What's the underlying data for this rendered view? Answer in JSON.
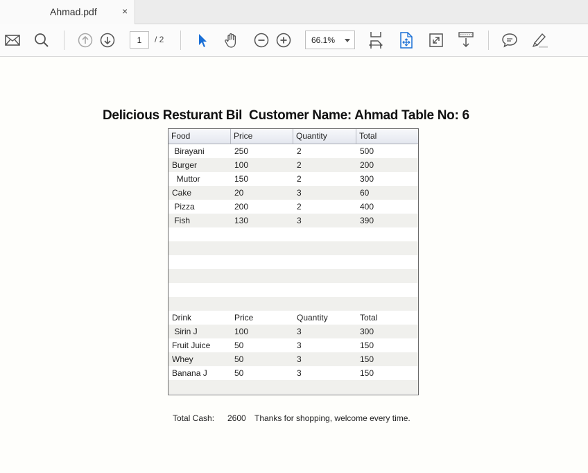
{
  "tab": {
    "title": "Ahmad.pdf",
    "close": "×"
  },
  "toolbar": {
    "page_current": "1",
    "page_total": "/ 2",
    "zoom": "66.1%",
    "icons": [
      "mail-icon",
      "search-icon",
      "previous-page-icon",
      "next-page-icon",
      "select-arrow-icon",
      "hand-tool-icon",
      "zoom-out-icon",
      "zoom-in-icon",
      "fit-page-icon",
      "rotate-icon",
      "full-screen-icon",
      "scroll-mode-icon",
      "comment-icon",
      "highlight-pen-icon"
    ]
  },
  "document": {
    "title": "Delicious Resturant Bil  Customer Name: Ahmad Table No: 6",
    "columns": [
      "Food",
      "Price",
      "Quantity",
      "Total"
    ],
    "rows": [
      [
        " Birayani",
        "250",
        "2",
        "500"
      ],
      [
        "Burger",
        "100",
        "2",
        "200"
      ],
      [
        "  Muttor",
        "150",
        "2",
        "300"
      ],
      [
        "Cake",
        "20",
        "3",
        "60"
      ],
      [
        " Pizza",
        "200",
        "2",
        "400"
      ],
      [
        " Fish",
        "130",
        "3",
        "390"
      ],
      [
        "",
        "",
        "",
        ""
      ],
      [
        "",
        "",
        "",
        ""
      ],
      [
        "",
        "",
        "",
        ""
      ],
      [
        "",
        "",
        "",
        ""
      ],
      [
        "",
        "",
        "",
        ""
      ],
      [
        "",
        "",
        "",
        ""
      ],
      [
        "Drink",
        "Price",
        "Quantity",
        "Total"
      ],
      [
        " Sirin J",
        "100",
        "3",
        "300"
      ],
      [
        "Fruit Juice",
        "50",
        "3",
        "150"
      ],
      [
        "Whey",
        "50",
        "3",
        "150"
      ],
      [
        "Banana J",
        "50",
        "3",
        "150"
      ],
      [
        "",
        "",
        "",
        ""
      ],
      [
        "",
        "",
        "",
        ""
      ]
    ],
    "total_label": "Total Cash:",
    "total_value": "2600",
    "thanks": "Thanks for shopping, welcome every time."
  }
}
